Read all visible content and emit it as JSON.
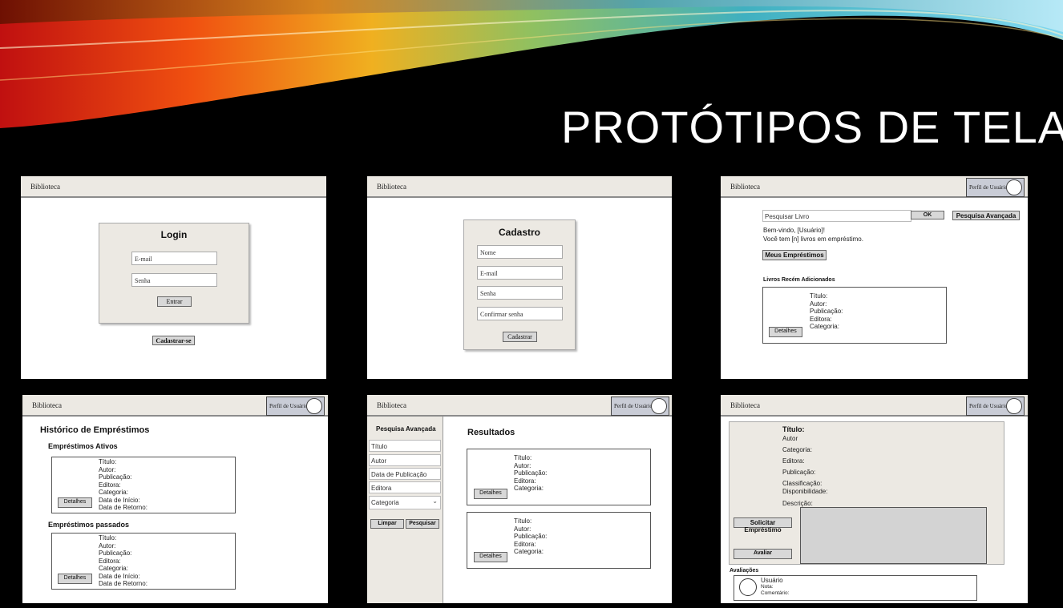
{
  "slide": {
    "title": "PROTÓTIPOS DE TELA"
  },
  "app": {
    "name": "Biblioteca",
    "profile_label": "Perfil de Usuário"
  },
  "login": {
    "heading": "Login",
    "email_placeholder": "E-mail",
    "password_placeholder": "Senha",
    "submit_label": "Entrar",
    "register_label": "Cadastrar-se"
  },
  "signup": {
    "heading": "Cadastro",
    "name_placeholder": "Nome",
    "email_placeholder": "E-mail",
    "password_placeholder": "Senha",
    "confirm_placeholder": "Confirmar senha",
    "submit_label": "Cadastrar"
  },
  "home": {
    "search_placeholder": "Pesquisar Livro",
    "ok_label": "OK",
    "advanced_label": "Pesquisa Avançada",
    "welcome": "Bem-vindo, [Usuário]!",
    "loans_count": "Você tem [n] livros em empréstimo.",
    "my_loans_label": "Meus Empréstimos",
    "recent_heading": "Livros Recém Adicionados",
    "book_fields": [
      "Título:",
      "Autor:",
      "Publicação:",
      "Editora:",
      "Categoria:"
    ],
    "details_label": "Detalhes"
  },
  "history": {
    "heading": "Histórico de Empréstimos",
    "active_heading": "Empréstimos Ativos",
    "past_heading": "Empréstimos passados",
    "loan_fields": [
      "Título:",
      "Autor:",
      "Publicação:",
      "Editora:",
      "Categoria:",
      "Data de Início:",
      "Data de Retorno:"
    ],
    "details_label": "Detalhes"
  },
  "advanced": {
    "heading": "Pesquisa Avançada",
    "title_placeholder": "Título",
    "author_placeholder": "Autor",
    "date_placeholder": "Data de Publicação",
    "publisher_placeholder": "Editora",
    "category_selected": "Categoria",
    "clear_label": "Limpar",
    "search_label": "Pesquisar",
    "results_heading": "Resultados",
    "book_fields": [
      "Título:",
      "Autor:",
      "Publicação:",
      "Editora:",
      "Categoria:"
    ],
    "details_label": "Detalhes"
  },
  "detail": {
    "title_label": "Título:",
    "fields": [
      "Autor",
      "Categoria:",
      "Editora:",
      "Publicação:",
      "Classificação:",
      "Disponibilidade:",
      "Descrição:"
    ],
    "request_label": "Solicitar Empréstimo",
    "rate_label": "Avaliar",
    "reviews_heading": "Avaliações",
    "review_user": "Usuário",
    "review_rating": "Nota:",
    "review_comment": "Comentário:"
  }
}
